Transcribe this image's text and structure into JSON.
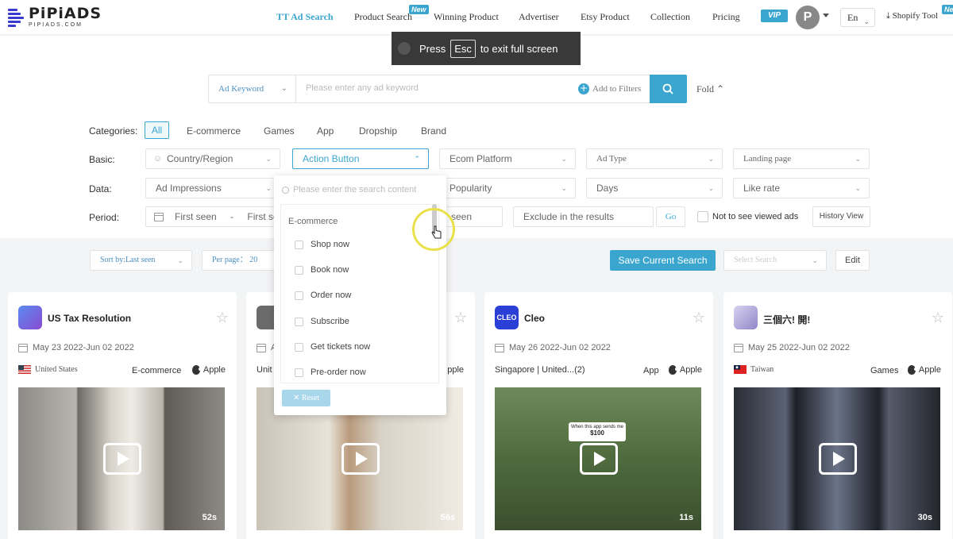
{
  "brand": {
    "name": "PiPiADS",
    "domain": "PIPIADS.COM",
    "color": "#3aa6d0"
  },
  "nav": {
    "items": [
      "TT Ad Search",
      "Product Search",
      "Winning Product",
      "Advertiser",
      "Etsy Product",
      "Collection",
      "Pricing"
    ],
    "new_badge": "New",
    "vip": "VIP",
    "avatar_letter": "P",
    "lang": "En",
    "shopify": "Shopify Tool",
    "shopify_badge": "Ne"
  },
  "toast": {
    "press": "Press",
    "key": "Esc",
    "rest": "to exit full screen"
  },
  "search": {
    "type": "Ad Keyword",
    "placeholder": "Please enter any ad keyword",
    "add_filters": "Add to Filters",
    "fold": "Fold"
  },
  "filters": {
    "categories_label": "Categories:",
    "categories": [
      "All",
      "E-commerce",
      "Games",
      "App",
      "Dropship",
      "Brand"
    ],
    "basic_label": "Basic:",
    "basic": [
      "Country/Region",
      "Action Button",
      "Ecom Platform",
      "Ad Type",
      "Landing page"
    ],
    "data_label": "Data:",
    "data": [
      "Ad Impressions",
      "Popularity",
      "Days",
      "Like rate"
    ],
    "period_label": "Period:",
    "first_seen": "First seen",
    "first_seen2": "First se",
    "dash": "-",
    "seen_tail": "seen",
    "exclude": "Exclude in the results",
    "go": "Go",
    "not_viewed": "Not to see viewed ads",
    "history": "History View"
  },
  "sortbar": {
    "sort": "Sort by:Last seen",
    "per_page": "Per page： 20",
    "save": "Save Current Search",
    "select_search": "Select Search",
    "edit": "Edit"
  },
  "dropdown": {
    "search_placeholder": "Please enter the search content",
    "group": "E-commerce",
    "items": [
      "Shop now",
      "Book now",
      "Order now",
      "Subscribe",
      "Get tickets now",
      "Pre-order now"
    ],
    "reset": "Reset"
  },
  "cards": [
    {
      "title": "US Tax Resolution",
      "date": "May 23 2022-Jun 02 2022",
      "region": "United States",
      "category": "E-commerce",
      "platform": "Apple",
      "duration": "52s"
    },
    {
      "title": "",
      "date": "A",
      "region": "Unit",
      "category": "",
      "platform": "pple",
      "duration": "56s"
    },
    {
      "title": "Cleo",
      "date": "May 26 2022-Jun 02 2022",
      "region": "Singapore | United...(2)",
      "category": "App",
      "platform": "Apple",
      "duration": "11s",
      "icon_text": "CLEO"
    },
    {
      "title": "三個六! 開!",
      "date": "May 25 2022-Jun 02 2022",
      "region": "Taiwan",
      "category": "Games",
      "platform": "Apple",
      "duration": "30s"
    }
  ],
  "thumb_caption": "When this app sends me",
  "thumb_price": "$100"
}
